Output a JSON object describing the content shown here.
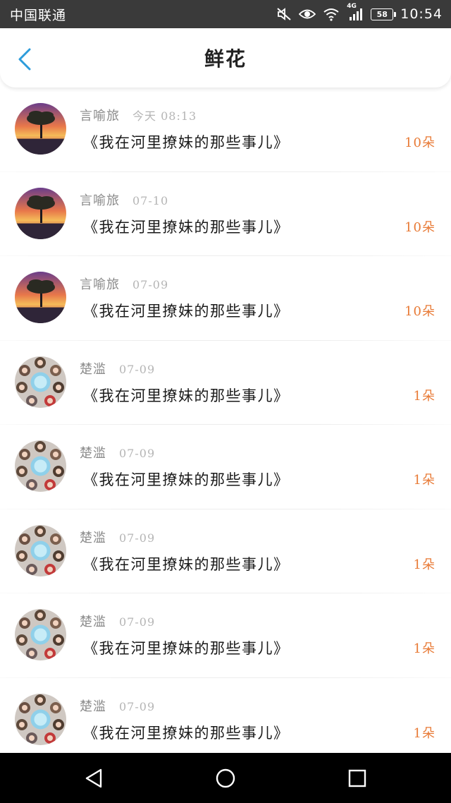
{
  "status_bar": {
    "carrier": "中国联通",
    "network": "4G",
    "battery": "58",
    "time": "10:54",
    "icons": [
      "mute-icon",
      "eye-icon",
      "wifi-icon",
      "signal-icon",
      "battery-icon"
    ]
  },
  "header": {
    "title": "鲜花",
    "back_icon": "chevron-left-icon"
  },
  "colors": {
    "accent": "#2d9cdb",
    "flower_count": "#e87a36",
    "name": "#8a8a8a",
    "date": "#b5b5b5",
    "title": "#1a1a1a"
  },
  "list": {
    "items": [
      {
        "avatar": "sunset-tree-avatar",
        "name": "言喻旅",
        "date": "今天 08:13",
        "title": "《我在河里撩妹的那些事儿》",
        "count": "10朵"
      },
      {
        "avatar": "sunset-tree-avatar",
        "name": "言喻旅",
        "date": "07-10",
        "title": "《我在河里撩妹的那些事儿》",
        "count": "10朵"
      },
      {
        "avatar": "sunset-tree-avatar",
        "name": "言喻旅",
        "date": "07-09",
        "title": "《我在河里撩妹的那些事儿》",
        "count": "10朵"
      },
      {
        "avatar": "group-photo-avatar",
        "name": "楚滥",
        "date": "07-09",
        "title": "《我在河里撩妹的那些事儿》",
        "count": "1朵"
      },
      {
        "avatar": "group-photo-avatar",
        "name": "楚滥",
        "date": "07-09",
        "title": "《我在河里撩妹的那些事儿》",
        "count": "1朵"
      },
      {
        "avatar": "group-photo-avatar",
        "name": "楚滥",
        "date": "07-09",
        "title": "《我在河里撩妹的那些事儿》",
        "count": "1朵"
      },
      {
        "avatar": "group-photo-avatar",
        "name": "楚滥",
        "date": "07-09",
        "title": "《我在河里撩妹的那些事儿》",
        "count": "1朵"
      },
      {
        "avatar": "group-photo-avatar",
        "name": "楚滥",
        "date": "07-09",
        "title": "《我在河里撩妹的那些事儿》",
        "count": "1朵"
      }
    ]
  },
  "nav_bar": {
    "buttons": [
      "back-triangle-icon",
      "home-circle-icon",
      "recents-square-icon"
    ]
  }
}
